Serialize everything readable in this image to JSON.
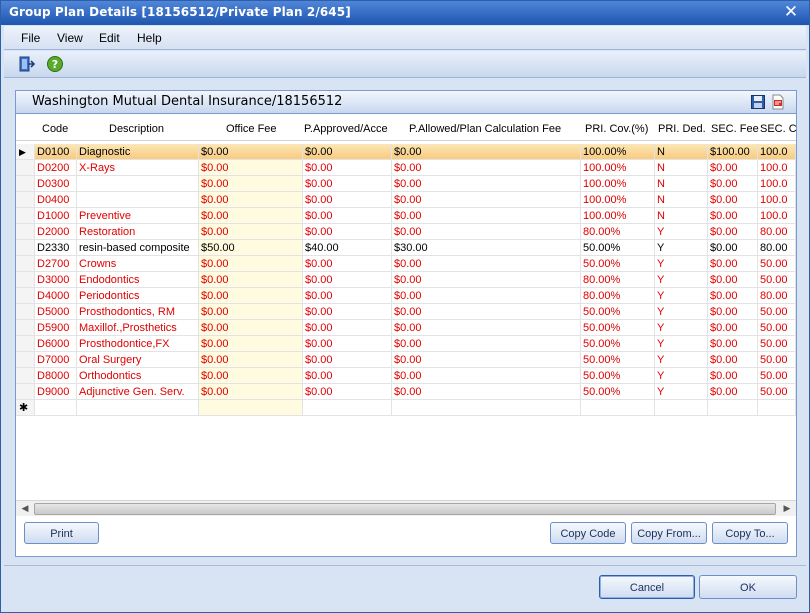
{
  "window": {
    "title": "Group Plan Details [18156512/Private Plan 2/645]",
    "close_glyph": "✕"
  },
  "menu": [
    "File",
    "View",
    "Edit",
    "Help"
  ],
  "panel": {
    "title": "Washington Mutual Dental Insurance/18156512"
  },
  "columns": [
    "Code",
    "Description",
    "Office Fee",
    "P.Approved/Acce",
    "P.Allowed/Plan Calculation Fee",
    "PRI. Cov.(%)",
    "PRI. Ded.",
    "SEC. Fee",
    "SEC. C"
  ],
  "rows": [
    {
      "code": "D0100",
      "desc": "Diagnostic",
      "office": "$0.00",
      "approved": "$0.00",
      "allowed": "$0.00",
      "pri_cov": "100.00%",
      "pri_ded": "N",
      "sec_fee": "$100.00",
      "sec_c": "100.0",
      "style": "selected"
    },
    {
      "code": "D0200",
      "desc": "X-Rays",
      "office": "$0.00",
      "approved": "$0.00",
      "allowed": "$0.00",
      "pri_cov": "100.00%",
      "pri_ded": "N",
      "sec_fee": "$0.00",
      "sec_c": "100.0",
      "style": "red"
    },
    {
      "code": "D0300",
      "desc": "",
      "office": "$0.00",
      "approved": "$0.00",
      "allowed": "$0.00",
      "pri_cov": "100.00%",
      "pri_ded": "N",
      "sec_fee": "$0.00",
      "sec_c": "100.0",
      "style": "red"
    },
    {
      "code": "D0400",
      "desc": "",
      "office": "$0.00",
      "approved": "$0.00",
      "allowed": "$0.00",
      "pri_cov": "100.00%",
      "pri_ded": "N",
      "sec_fee": "$0.00",
      "sec_c": "100.0",
      "style": "red"
    },
    {
      "code": "D1000",
      "desc": "Preventive",
      "office": "$0.00",
      "approved": "$0.00",
      "allowed": "$0.00",
      "pri_cov": "100.00%",
      "pri_ded": "N",
      "sec_fee": "$0.00",
      "sec_c": "100.0",
      "style": "red"
    },
    {
      "code": "D2000",
      "desc": "Restoration",
      "office": "$0.00",
      "approved": "$0.00",
      "allowed": "$0.00",
      "pri_cov": "80.00%",
      "pri_ded": "Y",
      "sec_fee": "$0.00",
      "sec_c": "80.00",
      "style": "red"
    },
    {
      "code": "D2330",
      "desc": "resin-based composite",
      "office": "$50.00",
      "approved": "$40.00",
      "allowed": "$30.00",
      "pri_cov": "50.00%",
      "pri_ded": "Y",
      "sec_fee": "$0.00",
      "sec_c": "80.00",
      "style": "black"
    },
    {
      "code": "D2700",
      "desc": "Crowns",
      "office": "$0.00",
      "approved": "$0.00",
      "allowed": "$0.00",
      "pri_cov": "50.00%",
      "pri_ded": "Y",
      "sec_fee": "$0.00",
      "sec_c": "50.00",
      "style": "red"
    },
    {
      "code": "D3000",
      "desc": "Endodontics",
      "office": "$0.00",
      "approved": "$0.00",
      "allowed": "$0.00",
      "pri_cov": "80.00%",
      "pri_ded": "Y",
      "sec_fee": "$0.00",
      "sec_c": "50.00",
      "style": "red"
    },
    {
      "code": "D4000",
      "desc": "Periodontics",
      "office": "$0.00",
      "approved": "$0.00",
      "allowed": "$0.00",
      "pri_cov": "80.00%",
      "pri_ded": "Y",
      "sec_fee": "$0.00",
      "sec_c": "80.00",
      "style": "red"
    },
    {
      "code": "D5000",
      "desc": "Prosthodontics, RM",
      "office": "$0.00",
      "approved": "$0.00",
      "allowed": "$0.00",
      "pri_cov": "50.00%",
      "pri_ded": "Y",
      "sec_fee": "$0.00",
      "sec_c": "50.00",
      "style": "red"
    },
    {
      "code": "D5900",
      "desc": "Maxillof.,Prosthetics",
      "office": "$0.00",
      "approved": "$0.00",
      "allowed": "$0.00",
      "pri_cov": "50.00%",
      "pri_ded": "Y",
      "sec_fee": "$0.00",
      "sec_c": "50.00",
      "style": "red"
    },
    {
      "code": "D6000",
      "desc": "Prosthodontice,FX",
      "office": "$0.00",
      "approved": "$0.00",
      "allowed": "$0.00",
      "pri_cov": "50.00%",
      "pri_ded": "Y",
      "sec_fee": "$0.00",
      "sec_c": "50.00",
      "style": "red"
    },
    {
      "code": "D7000",
      "desc": "Oral Surgery",
      "office": "$0.00",
      "approved": "$0.00",
      "allowed": "$0.00",
      "pri_cov": "50.00%",
      "pri_ded": "Y",
      "sec_fee": "$0.00",
      "sec_c": "50.00",
      "style": "red"
    },
    {
      "code": "D8000",
      "desc": "Orthodontics",
      "office": "$0.00",
      "approved": "$0.00",
      "allowed": "$0.00",
      "pri_cov": "50.00%",
      "pri_ded": "Y",
      "sec_fee": "$0.00",
      "sec_c": "50.00",
      "style": "red"
    },
    {
      "code": "D9000",
      "desc": "Adjunctive Gen. Serv.",
      "office": "$0.00",
      "approved": "$0.00",
      "allowed": "$0.00",
      "pri_cov": "50.00%",
      "pri_ded": "Y",
      "sec_fee": "$0.00",
      "sec_c": "50.00",
      "style": "red"
    }
  ],
  "new_row_glyph": "✱",
  "current_row_glyph": "▶",
  "buttons": {
    "print": "Print",
    "copy_code": "Copy Code",
    "copy_from": "Copy From...",
    "copy_to": "Copy To...",
    "cancel": "Cancel",
    "ok": "OK"
  },
  "colors": {
    "title_bar": "#1e55b0",
    "row_text_red": "#e00000",
    "selected_row": "#f7c97c",
    "office_fee_col": "#fffbe0"
  }
}
